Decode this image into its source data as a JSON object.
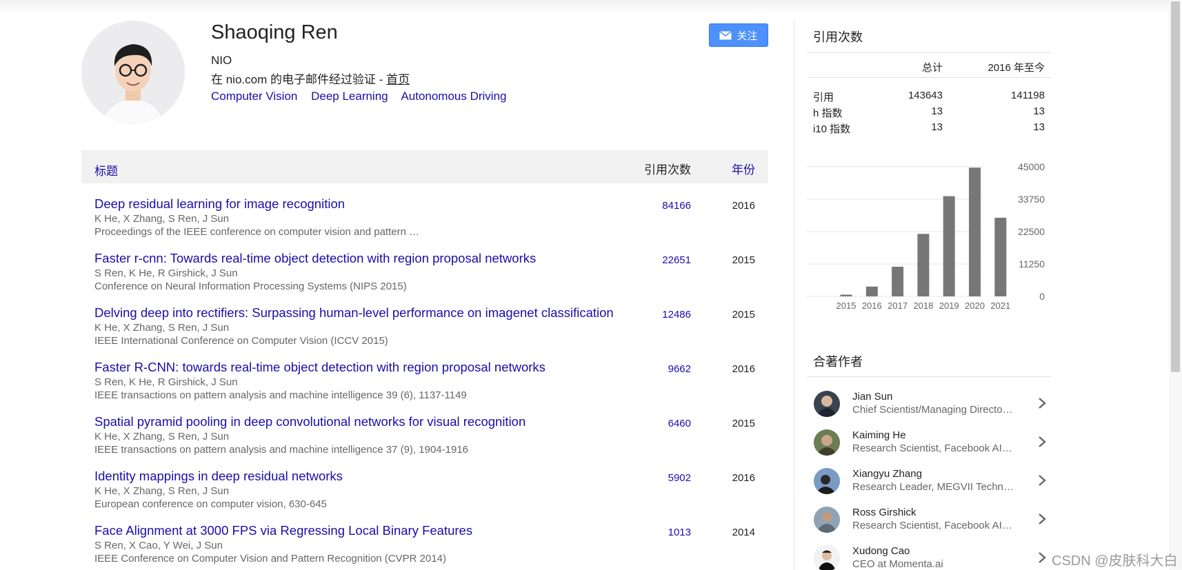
{
  "profile": {
    "name": "Shaoqing Ren",
    "affiliation": "NIO",
    "email_prefix": "在 nio.com 的电子邮件经过验证 - ",
    "homepage": "首页",
    "interests": [
      "Computer Vision",
      "Deep Learning",
      "Autonomous Driving"
    ],
    "follow_label": "关注"
  },
  "table": {
    "header_title": "标题",
    "header_cites": "引用次数",
    "header_year": "年份",
    "rows": [
      {
        "title": "Deep residual learning for image recognition",
        "authors": "K He, X Zhang, S Ren, J Sun",
        "venue": "Proceedings of the IEEE conference on computer vision and pattern …",
        "cites": "84166",
        "year": "2016"
      },
      {
        "title": "Faster r-cnn: Towards real-time object detection with region proposal networks",
        "authors": "S Ren, K He, R Girshick, J Sun",
        "venue": "Conference on Neural Information Processing Systems (NIPS 2015)",
        "cites": "22651",
        "year": "2015"
      },
      {
        "title": "Delving deep into rectifiers: Surpassing human-level performance on imagenet classification",
        "authors": "K He, X Zhang, S Ren, J Sun",
        "venue": "IEEE International Conference on Computer Vision (ICCV 2015)",
        "cites": "12486",
        "year": "2015"
      },
      {
        "title": "Faster R-CNN: towards real-time object detection with region proposal networks",
        "authors": "S Ren, K He, R Girshick, J Sun",
        "venue": "IEEE transactions on pattern analysis and machine intelligence 39 (6), 1137-1149",
        "cites": "9662",
        "year": "2016"
      },
      {
        "title": "Spatial pyramid pooling in deep convolutional networks for visual recognition",
        "authors": "K He, X Zhang, S Ren, J Sun",
        "venue": "IEEE transactions on pattern analysis and machine intelligence 37 (9), 1904-1916",
        "cites": "6460",
        "year": "2015"
      },
      {
        "title": "Identity mappings in deep residual networks",
        "authors": "K He, X Zhang, S Ren, J Sun",
        "venue": "European conference on computer vision, 630-645",
        "cites": "5902",
        "year": "2016"
      },
      {
        "title": "Face Alignment at 3000 FPS via Regressing Local Binary Features",
        "authors": "S Ren, X Cao, Y Wei, J Sun",
        "venue": "IEEE Conference on Computer Vision and Pattern Recognition (CVPR 2014)",
        "cites": "1013",
        "year": "2014"
      }
    ]
  },
  "citations": {
    "title": "引用次数",
    "col_all": "总计",
    "col_since": "2016 年至今",
    "rows": [
      {
        "label": "引用",
        "all": "143643",
        "since": "141198"
      },
      {
        "label": "h 指数",
        "all": "13",
        "since": "13"
      },
      {
        "label": "i10 指数",
        "all": "13",
        "since": "13"
      }
    ]
  },
  "chart_data": {
    "type": "bar",
    "categories": [
      "2015",
      "2016",
      "2017",
      "2018",
      "2019",
      "2020",
      "2021"
    ],
    "values": [
      600,
      3400,
      10300,
      21700,
      34800,
      44700,
      27300
    ],
    "ylim": [
      0,
      45000
    ],
    "yticks": [
      "0",
      "11250",
      "22500",
      "33750",
      "45000"
    ],
    "bar_color": "#777777",
    "grid": true
  },
  "coauthors": {
    "title": "合著作者",
    "items": [
      {
        "name": "Jian Sun",
        "desc": "Chief Scientist/Managing Directo…"
      },
      {
        "name": "Kaiming He",
        "desc": "Research Scientist, Facebook AI…"
      },
      {
        "name": "Xiangyu Zhang",
        "desc": "Research Leader, MEGVII Techn…"
      },
      {
        "name": "Ross Girshick",
        "desc": "Research Scientist, Facebook AI…"
      },
      {
        "name": "Xudong Cao",
        "desc": "CEO at Momenta.ai"
      }
    ]
  },
  "watermark": "CSDN @皮肤科大白"
}
